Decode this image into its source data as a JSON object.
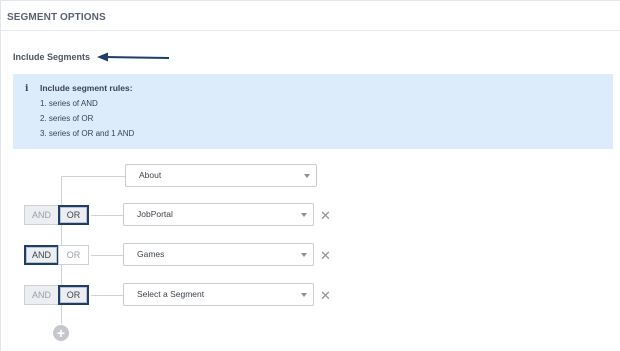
{
  "section": {
    "title": "SEGMENT OPTIONS"
  },
  "include": {
    "heading": "Include Segments"
  },
  "info": {
    "icon": "info-icon",
    "title": "Include segment rules:",
    "rules": [
      "1. series of AND",
      "2. series of OR",
      "3. series of OR and 1 AND"
    ]
  },
  "rows": [
    {
      "segment": "About"
    },
    {
      "segment": "JobPortal",
      "and_label": "AND",
      "or_label": "OR",
      "selected": "OR"
    },
    {
      "segment": "Games",
      "and_label": "AND",
      "or_label": "OR",
      "selected": "AND"
    },
    {
      "segment": "Select a Segment",
      "and_label": "AND",
      "or_label": "OR",
      "selected": "OR"
    }
  ],
  "remove_glyph": "✕",
  "add_glyph": "+",
  "colors": {
    "accent_border": "#1f3e66",
    "info_background": "#dcecfb",
    "arrow": "#1f3e66"
  }
}
